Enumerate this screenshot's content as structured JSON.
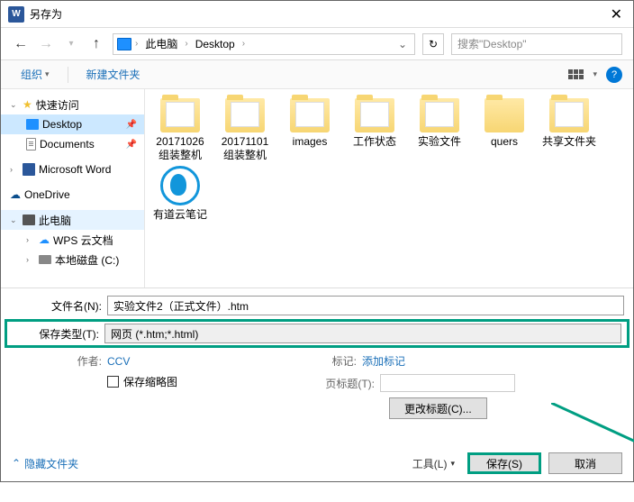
{
  "title": "另存为",
  "nav": {
    "pc": "此电脑",
    "desktop": "Desktop"
  },
  "search": {
    "placeholder": "搜索\"Desktop\""
  },
  "toolbar": {
    "organize": "组织",
    "newfolder": "新建文件夹"
  },
  "sidebar": {
    "quick": "快速访问",
    "desktop": "Desktop",
    "documents": "Documents",
    "word": "Microsoft Word",
    "onedrive": "OneDrive",
    "pc": "此电脑",
    "wps": "WPS 云文档",
    "disk": "本地磁盘 (C:)"
  },
  "files": [
    {
      "label": "20171026组装整机",
      "type": "folder-full"
    },
    {
      "label": "20171101组装整机",
      "type": "folder-full"
    },
    {
      "label": "images",
      "type": "folder-img"
    },
    {
      "label": "工作状态",
      "type": "folder-full"
    },
    {
      "label": "实验文件",
      "type": "folder-full"
    },
    {
      "label": "quers",
      "type": "folder"
    },
    {
      "label": "共享文件夹",
      "type": "folder-img"
    },
    {
      "label": "有道云笔记",
      "type": "qq"
    }
  ],
  "form": {
    "filename_label": "文件名(N):",
    "filename_value": "实验文件2（正式文件）.htm",
    "type_label": "保存类型(T):",
    "type_value": "网页 (*.htm;*.html)",
    "author_label": "作者:",
    "author_value": "CCV",
    "tag_label": "标记:",
    "tag_value": "添加标记",
    "thumb": "保存缩略图",
    "pagetitle_label": "页标题(T):",
    "change_title": "更改标题(C)..."
  },
  "footer": {
    "hide": "隐藏文件夹",
    "tools": "工具(L)",
    "save": "保存(S)",
    "cancel": "取消"
  }
}
